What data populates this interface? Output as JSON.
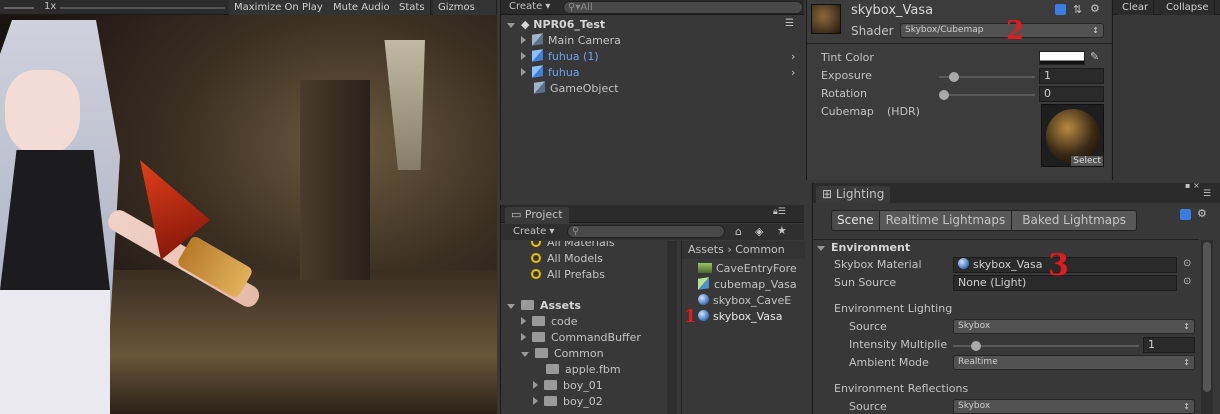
{
  "game_toolbar": {
    "zoom": "1x",
    "buttons": [
      "Maximize On Play",
      "Mute Audio",
      "Stats",
      "Gizmos"
    ]
  },
  "hierarchy": {
    "create": "Create",
    "search_placeholder": "All",
    "scene": "NPR06_Test",
    "items": [
      {
        "label": "Main Camera",
        "blue": false,
        "expand": true
      },
      {
        "label": "fuhua (1)",
        "blue": true,
        "expand": true
      },
      {
        "label": "fuhua",
        "blue": true,
        "expand": true
      },
      {
        "label": "GameObject",
        "blue": false,
        "expand": false
      }
    ]
  },
  "inspector": {
    "title": "skybox_Vasa",
    "shader_label": "Shader",
    "shader_value": "Skybox/Cubemap",
    "tint_label": "Tint Color",
    "exposure_label": "Exposure",
    "exposure_value": "1",
    "rotation_label": "Rotation",
    "rotation_value": "0",
    "cubemap_label": "Cubemap",
    "cubemap_hdr": "(HDR)",
    "select": "Select"
  },
  "console": {
    "clear": "Clear",
    "collapse": "Collapse"
  },
  "project": {
    "tab": "Project",
    "create": "Create",
    "favorites": [
      "All Materials",
      "All Models",
      "All Prefabs"
    ],
    "assets_root": "Assets",
    "tree": [
      {
        "label": "code",
        "expand": true
      },
      {
        "label": "CommandBuffer",
        "expand": true
      },
      {
        "label": "Common",
        "expand": "down"
      },
      {
        "label": "apple.fbm",
        "expand": false
      },
      {
        "label": "boy_01",
        "expand": true
      },
      {
        "label": "boy_02",
        "expand": true
      }
    ],
    "breadcrumb": [
      "Assets",
      "Common"
    ],
    "files": [
      "CaveEntryFore",
      "cubemap_Vasa",
      "skybox_CaveE",
      "skybox_Vasa"
    ]
  },
  "lighting": {
    "tab": "Lighting",
    "tabs": [
      "Scene",
      "Realtime Lightmaps",
      "Baked Lightmaps"
    ],
    "env_header": "Environment",
    "skybox_label": "Skybox Material",
    "skybox_value": "skybox_Vasa",
    "sun_label": "Sun Source",
    "sun_value": "None (Light)",
    "env_lighting": "Environment Lighting",
    "source_label": "Source",
    "source_value": "Skybox",
    "intensity_label": "Intensity Multiplie",
    "intensity_value": "1",
    "ambient_label": "Ambient Mode",
    "ambient_value": "Realtime",
    "env_reflections": "Environment Reflections",
    "refl_source_label": "Source",
    "refl_source_value": "Skybox"
  },
  "annotations": [
    "1",
    "2",
    "3"
  ]
}
